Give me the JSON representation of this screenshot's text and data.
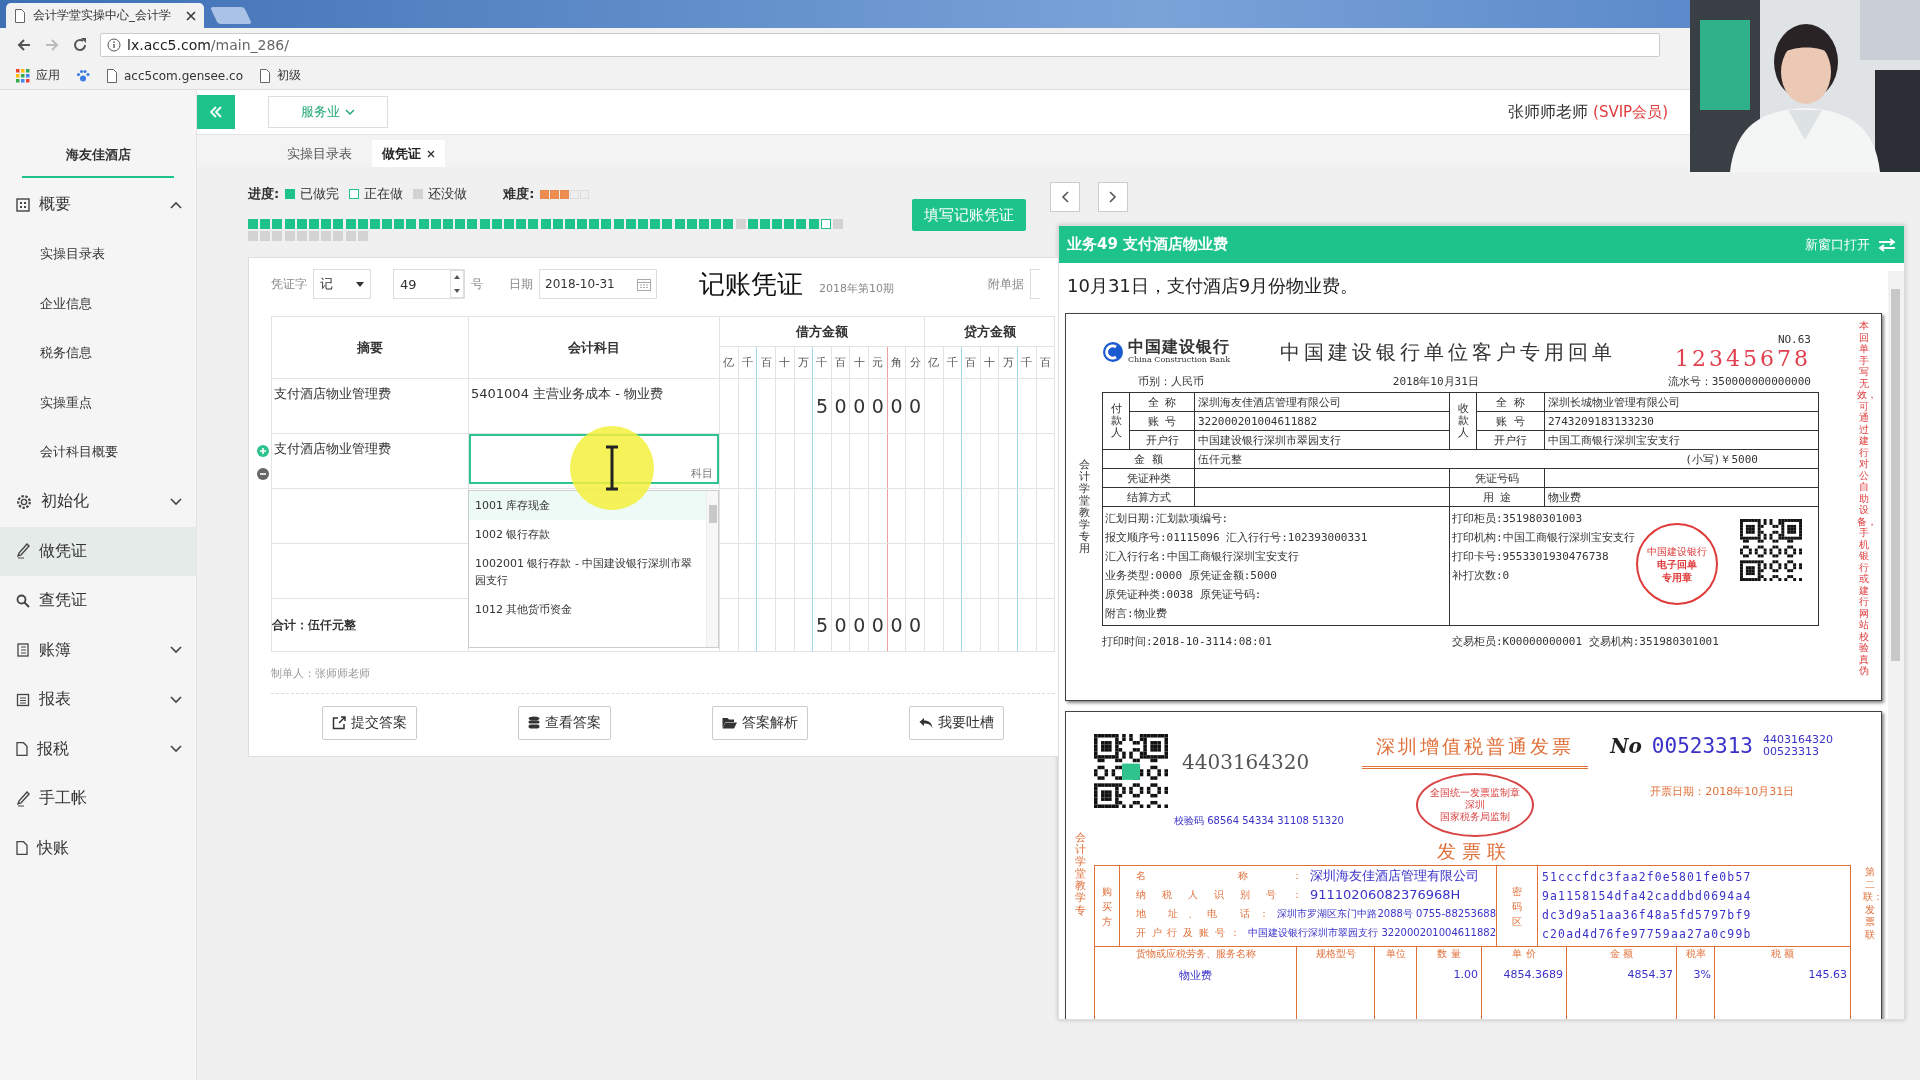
{
  "browser": {
    "tab_title": "会计学堂实操中心_会计学",
    "url_host": "lx.acc5.com",
    "url_path": "/main_286/",
    "bookmarks": [
      {
        "kind": "apps",
        "label": "应用"
      },
      {
        "kind": "paw"
      },
      {
        "kind": "page",
        "label": "acc5com.gensee.co"
      },
      {
        "kind": "page",
        "label": "初级"
      }
    ]
  },
  "sidebar": {
    "company": "海友佳酒店",
    "items": [
      {
        "kind": "grid",
        "label": "概要",
        "selected": false,
        "expanded": true,
        "children": [
          {
            "label": "实操目录表"
          },
          {
            "label": "企业信息"
          },
          {
            "label": "税务信息"
          },
          {
            "label": "实操重点"
          },
          {
            "label": "会计科目概要"
          }
        ]
      },
      {
        "kind": "gear",
        "label": "初始化",
        "selected": false,
        "expanded": false
      },
      {
        "kind": "pencil",
        "label": "做凭证",
        "selected": true
      },
      {
        "kind": "search",
        "label": "查凭证",
        "selected": false
      },
      {
        "kind": "book",
        "label": "账簿",
        "selected": false,
        "expanded": false
      },
      {
        "kind": "report",
        "label": "报表",
        "selected": false,
        "expanded": false
      },
      {
        "kind": "doc",
        "label": "报税",
        "selected": false,
        "expanded": false
      },
      {
        "kind": "pencil",
        "label": "手工帐",
        "selected": false
      },
      {
        "kind": "doc",
        "label": "快账",
        "selected": false
      }
    ]
  },
  "header": {
    "industry": "服务业",
    "user": "张师师老师",
    "badge": "(SVIP会员)"
  },
  "tabs": [
    {
      "label": "实操目录表",
      "selected": false,
      "closable": false
    },
    {
      "label": "做凭证",
      "selected": true,
      "closable": true
    }
  ],
  "progress": {
    "label": "进度:",
    "legend": [
      {
        "kind": "done",
        "label": "已做完"
      },
      {
        "kind": "doing",
        "label": "正在做"
      },
      {
        "kind": "todo",
        "label": "还没做"
      }
    ],
    "difficulty_label": "难度:",
    "stars": 3,
    "items": [
      {
        "kind": "done"
      },
      {
        "kind": "done"
      },
      {
        "kind": "done"
      },
      {
        "kind": "done"
      },
      {
        "kind": "done"
      },
      {
        "kind": "done"
      },
      {
        "kind": "done"
      },
      {
        "kind": "done"
      },
      {
        "kind": "done"
      },
      {
        "kind": "done"
      },
      {
        "kind": "done"
      },
      {
        "kind": "done"
      },
      {
        "kind": "done"
      },
      {
        "kind": "done"
      },
      {
        "kind": "done"
      },
      {
        "kind": "done"
      },
      {
        "kind": "done"
      },
      {
        "kind": "done"
      },
      {
        "kind": "done"
      },
      {
        "kind": "done"
      },
      {
        "kind": "done"
      },
      {
        "kind": "done"
      },
      {
        "kind": "done"
      },
      {
        "kind": "done"
      },
      {
        "kind": "done"
      },
      {
        "kind": "done"
      },
      {
        "kind": "done"
      },
      {
        "kind": "done"
      },
      {
        "kind": "done"
      },
      {
        "kind": "done"
      },
      {
        "kind": "done"
      },
      {
        "kind": "done"
      },
      {
        "kind": "done"
      },
      {
        "kind": "done"
      },
      {
        "kind": "done"
      },
      {
        "kind": "done"
      },
      {
        "kind": "done"
      },
      {
        "kind": "done"
      },
      {
        "kind": "done"
      },
      {
        "kind": "done"
      },
      {
        "kind": "todo"
      },
      {
        "kind": "done"
      },
      {
        "kind": "done"
      },
      {
        "kind": "done"
      },
      {
        "kind": "done"
      },
      {
        "kind": "done"
      },
      {
        "kind": "done"
      },
      {
        "kind": "doing"
      },
      {
        "kind": "todo"
      },
      {
        "kind": "todo"
      },
      {
        "kind": "todo"
      },
      {
        "kind": "todo"
      },
      {
        "kind": "todo"
      },
      {
        "kind": "todo"
      },
      {
        "kind": "todo"
      },
      {
        "kind": "todo"
      },
      {
        "kind": "todo"
      },
      {
        "kind": "todo"
      },
      {
        "kind": "todo"
      }
    ]
  },
  "fill_button": "填写记账凭证",
  "voucher": {
    "word_label": "凭证字",
    "word": "记",
    "number": "49",
    "number_suffix": "号",
    "date_label": "日期",
    "date": "2018-10-31",
    "title": "记账凭证",
    "period": "2018年第10期",
    "attachments_label": "附单据",
    "columns": {
      "summary": "摘要",
      "account": "会计科目",
      "debit": "借方金额",
      "credit": "贷方金额"
    },
    "debit_digits": [
      "亿",
      "千",
      "百",
      "十",
      "万",
      "千",
      "百",
      "十",
      "元",
      "角",
      "分"
    ],
    "credit_digits": [
      "亿",
      "千",
      "百",
      "十",
      "万",
      "千",
      "百"
    ],
    "rows": [
      {
        "summary": "支付酒店物业管理费",
        "account": "5401004 主营业务成本 - 物业费",
        "debit": [
          "5",
          "0",
          "0",
          "0",
          "0",
          "0"
        ],
        "active": false
      },
      {
        "summary": "支付酒店物业管理费",
        "account_placeholder": "科目",
        "active": true
      },
      {
        "active": false
      },
      {
        "active": false
      }
    ],
    "total": {
      "label": "合计：伍仟元整",
      "debit": [
        "5",
        "0",
        "0",
        "0",
        "0",
        "0"
      ]
    },
    "dropdown": [
      {
        "label": "1001 库存现金",
        "selected": true
      },
      {
        "label": "1002 银行存款",
        "selected": false
      },
      {
        "label": "1002001 银行存款 - 中国建设银行深圳市翠园支行",
        "selected": false
      },
      {
        "label": "1012 其他货币资金",
        "selected": false
      }
    ],
    "maker": "制单人：张师师老师",
    "actions": [
      {
        "kind": "external",
        "label": "提交答案"
      },
      {
        "kind": "database",
        "label": "查看答案"
      },
      {
        "kind": "folder",
        "label": "答案解析"
      },
      {
        "kind": "reply",
        "label": "我要吐槽"
      }
    ]
  },
  "task_panel": {
    "title": "业务49 支付酒店物业费",
    "open_new": "新窗口打开",
    "description": "10月31日，支付酒店9月份物业费。",
    "bank_receipt": {
      "logo_cn": "中国建设银行",
      "logo_en": "China Construction Bank",
      "title": "中国建设银行单位客户专用回单",
      "no": "NO.63",
      "serial": "12345678",
      "currency": "币别：人民币",
      "date": "2018年10月31日",
      "flow_no": "流水号：350000000000000",
      "payer_label": "付款人",
      "payee_label": "收款人",
      "party_rows": [
        {
          "label": "全 称",
          "payer": "深圳海友佳酒店管理有限公司",
          "payee_label": "全 称",
          "payee": "深圳长城物业管理有限公司"
        },
        {
          "label": "账 号",
          "payer": "322000201004611882",
          "payee_label": "账 号",
          "payee": "2743209183133230"
        },
        {
          "label": "开户行",
          "payer": "中国建设银行深圳市翠园支行",
          "payee_label": "开户行",
          "payee": "中国工商银行深圳宝安支行"
        }
      ],
      "amount_label": "金 额",
      "amount_words": "伍仟元整",
      "amount_figures": "(小写)￥5000",
      "info_rows": [
        {
          "label": "凭证种类",
          "label2": "凭证号码"
        },
        {
          "label": "结算方式",
          "label2": "用 途",
          "value2": "物业费"
        }
      ],
      "details_left": [
        "汇划日期:汇划款项编号:",
        "报文顺序号:01115096 汇入行行号:102393000331",
        "汇入行行名:中国工商银行深圳宝安支行",
        "业务类型:0000 原凭证金额:5000",
        "原凭证种类:0038 原凭证号码:",
        "附言:物业费"
      ],
      "details_right": [
        "打印柜员:351980301003",
        "打印机构:中国工商银行深圳宝安支行",
        "打印卡号:9553301930476738",
        "补打次数:0"
      ],
      "seal": [
        "中国建设银行",
        "电子回单",
        "专用章"
      ],
      "footer_left": "打印时间:2018-10-3114:08:01",
      "footer_right": "交易柜员:K00000000001 交易机构:351980301001",
      "side_left": "会计学堂教学专用",
      "side_right": "本回单手写无效，可通过建行对公自助设备，手机银行或建行网站校验真伪"
    },
    "invoice": {
      "code": "4403164320",
      "title": "深圳增值税普通发票",
      "copy": "发票联",
      "no_label": "No",
      "number": "00523313",
      "code_small": "4403164320",
      "number_small": "00523313",
      "date": "开票日期：2018年10月31日",
      "check_code": "校验码 68564 54334 31108 51320",
      "seal": [
        "全国统一发票监制章",
        "深圳",
        "国家税务局监制"
      ],
      "buyer_label": "购买方",
      "buyer_rows": [
        {
          "label": "名 称：",
          "value": "深圳海友佳酒店管理有限公司"
        },
        {
          "label": "纳税人识别号：",
          "value": "91110206082376968H"
        },
        {
          "label": "地 址、电 话：",
          "value": "深圳市罗湖区东门中路2088号 0755-88253688"
        },
        {
          "label": "开户行及账号：",
          "value": "中国建设银行深圳市翠园支行 322000201004611882"
        }
      ],
      "cipher_label": "密码区",
      "cipher": [
        "51cccfdc3faa2f0e5801fe0b57",
        "9a1158154dfa42caddbd0694a4",
        "dc3d9a51aa36f48a5fd5797bf9",
        "c20ad4d76fe97759aa27a0c99b"
      ],
      "item_headers": [
        "货物或应税劳务、服务名称",
        "规格型号",
        "单位",
        "数 量",
        "单 价",
        "金 额",
        "税率",
        "税 额"
      ],
      "items": [
        {
          "name": "物业费",
          "quantity": "1.00",
          "unit_price": "4854.3689",
          "amount": "4854.37",
          "tax_rate": "3%",
          "tax": "145.63"
        }
      ],
      "side_left": "会计学堂教学专",
      "side_right": "第二联：发票联"
    }
  }
}
